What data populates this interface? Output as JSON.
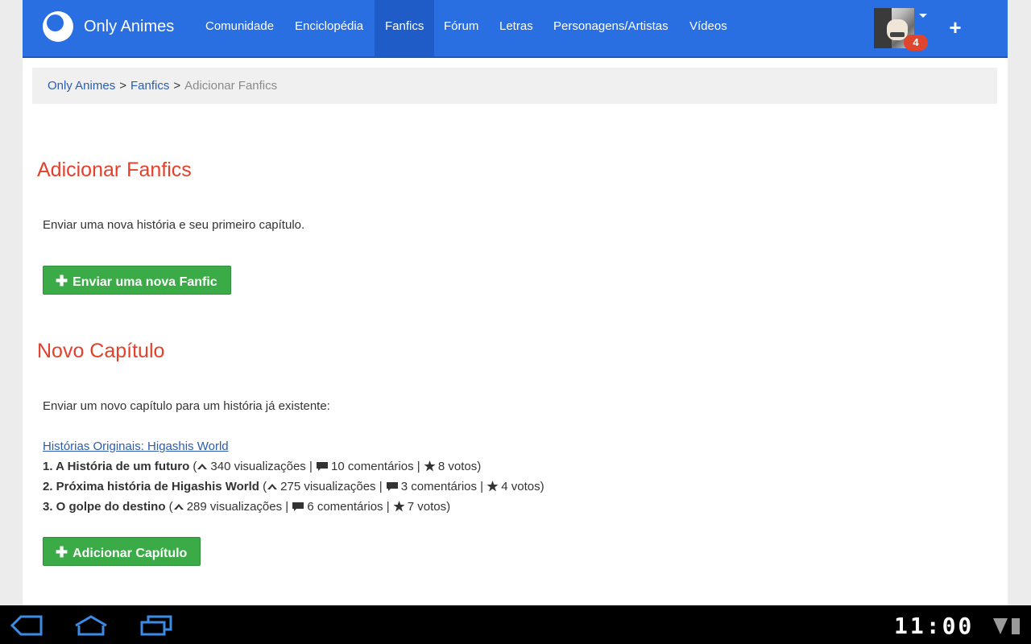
{
  "nav": {
    "brand": "Only Animes",
    "items": [
      {
        "label": "Comunidade",
        "active": false
      },
      {
        "label": "Enciclopédia",
        "active": false
      },
      {
        "label": "Fanfics",
        "active": true
      },
      {
        "label": "Fórum",
        "active": false
      },
      {
        "label": "Letras",
        "active": false
      },
      {
        "label": "Personagens/Artistas",
        "active": false
      },
      {
        "label": "Vídeos",
        "active": false
      }
    ],
    "notification_count": "4",
    "plus": "+"
  },
  "breadcrumb": {
    "home": "Only Animes",
    "section": "Fanfics",
    "current": "Adicionar Fanfics",
    "separator": ">"
  },
  "add_fanfic": {
    "title": "Adicionar Fanfics",
    "description": "Enviar uma nova história e seu primeiro capítulo.",
    "button_label": "Enviar uma nova Fanfic"
  },
  "new_chapter": {
    "title": "Novo Capítulo",
    "description": "Enviar um novo capítulo para um história já existente:",
    "story_link": "Histórias Originais: Higashis World",
    "chapters": [
      {
        "title": "1. A História de um futuro",
        "views": "340 visualizações",
        "comments": "10 comentários",
        "votes": "8 votos)"
      },
      {
        "title": "2. Próxima história de Higashis World",
        "views": "275 visualizações",
        "comments": "3 comentários",
        "votes": "4 votos)"
      },
      {
        "title": "3. O golpe do destino",
        "views": "289 visualizações",
        "comments": "6 comentários",
        "votes": "7 votos)"
      }
    ],
    "button_label": "Adicionar Capítulo"
  },
  "system_bar": {
    "clock": "11:00"
  },
  "colors": {
    "nav_bg": "#2a6fe2",
    "heading": "#e4402b",
    "button_green": "#3aab46",
    "link": "#2a5db0",
    "badge": "#e0452e"
  }
}
